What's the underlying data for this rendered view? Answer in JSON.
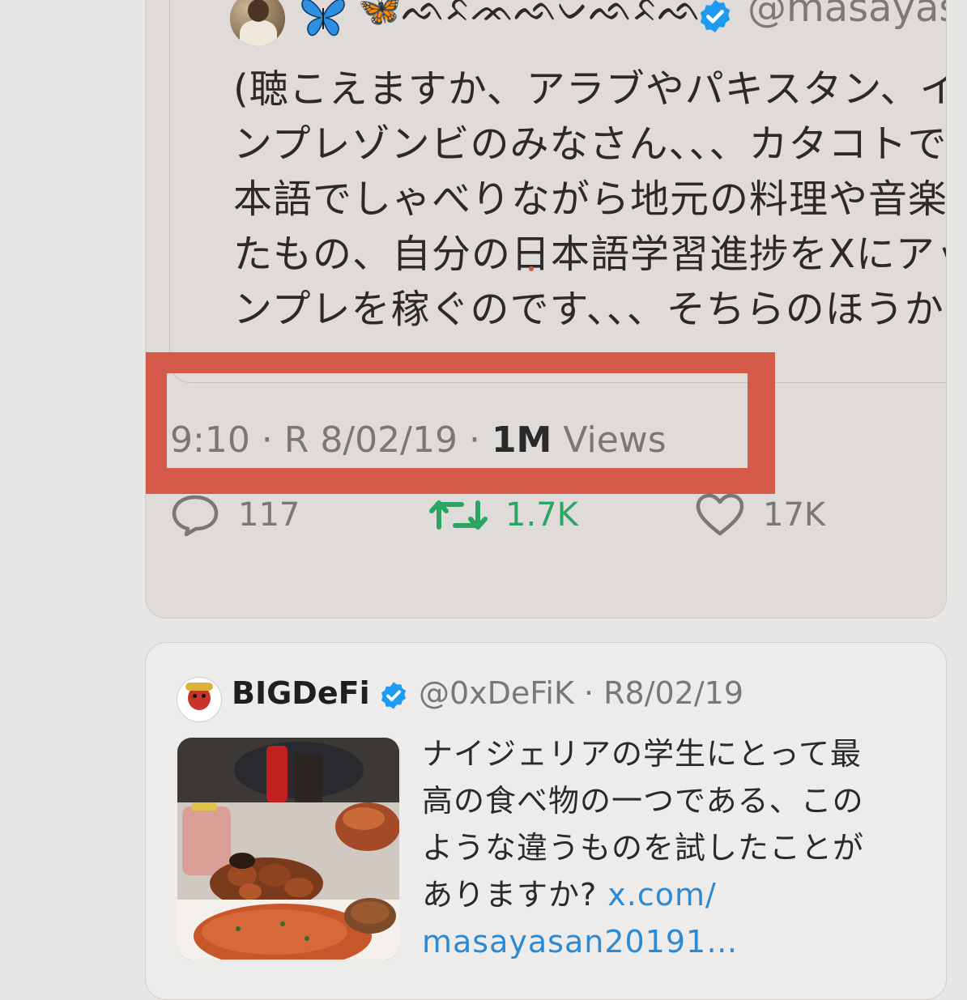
{
  "main_tweet": {
    "quoted": {
      "display_name": "🦋ᨒᨅᨏᨒᨆᨒᨅᨒ",
      "handle": "@masayasan",
      "text_lines": [
        "(聴こえますか、アラブやパキスタン、イ",
        "ンプレゾンビのみなさん、、、カタコトで",
        "本語でしゃべりながら地元の料理や音楽を",
        "たもの、自分の日本語学習進捗をXにアッ",
        "ンプレを稼ぐのです、、、そちらのほうか"
      ]
    },
    "meta": {
      "time": "9:10",
      "separator1": " · ",
      "date": "R 8/02/19",
      "separator2": " · ",
      "views_count": "1M",
      "views_label": " Views"
    },
    "actions": {
      "replies": "117",
      "retweets": "1.7K",
      "likes": "17K"
    }
  },
  "second_tweet": {
    "display_name": "BIGDeFi",
    "handle_date": "@0xDeFiK · R8/02/19",
    "text_lines": [
      "ナイジェリアの学生にとって最",
      "高の食べ物の一つである、この",
      "ような違うものを試したことが"
    ],
    "last_line_text": "ありますか? ",
    "link_part1": "x.com/",
    "link_part2": "masayasan20191…"
  },
  "colors": {
    "verified_blue": "#1d9bf0",
    "retweet_green": "#2aa564",
    "highlight_red": "#d55a4a",
    "link_blue": "#2a8ad6"
  }
}
